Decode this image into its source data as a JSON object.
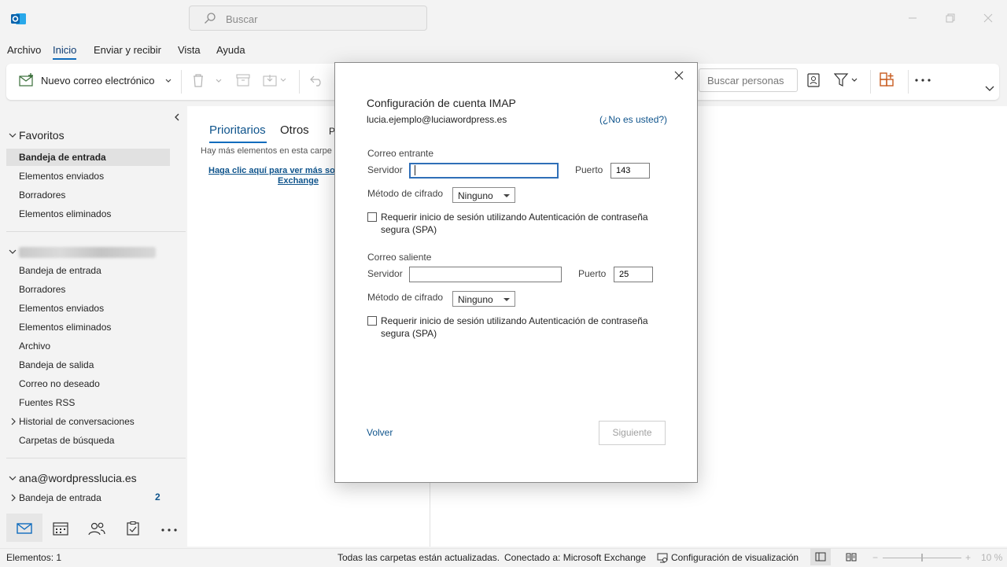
{
  "titlebar": {
    "search_placeholder": "Buscar"
  },
  "menu": {
    "items": [
      "Archivo",
      "Inicio",
      "Enviar y recibir",
      "Vista",
      "Ayuda"
    ]
  },
  "ribbon": {
    "new_mail": "Nuevo correo electrónico",
    "search_people": "Buscar personas"
  },
  "folders": {
    "favorites_header": "Favoritos",
    "favorites": [
      "Bandeja de entrada",
      "Elementos enviados",
      "Borradores",
      "Elementos eliminados"
    ],
    "account1_items": [
      "Bandeja de entrada",
      "Borradores",
      "Elementos enviados",
      "Elementos eliminados",
      "Archivo",
      "Bandeja de salida",
      "Correo no deseado",
      "Fuentes RSS",
      "Historial de conversaciones",
      "Carpetas de búsqueda"
    ],
    "account2_header": "ana@wordpresslucia.es",
    "account2_inbox": "Bandeja de entrada",
    "account2_inbox_count": "2"
  },
  "messages": {
    "tab_focused": "Prioritarios",
    "tab_other": "Otros",
    "tab_partial": "P",
    "notice": "Hay más elementos en esta carpe",
    "link_line1": "Haga clic aquí para ver más sob",
    "link_line2": "Exchange"
  },
  "dialog": {
    "title": "Configuración de cuenta IMAP",
    "email": "lucia.ejemplo@luciawordpress.es",
    "not_you": "(¿No es usted?)",
    "incoming": {
      "header": "Correo entrante",
      "server_label": "Servidor",
      "server_value": "",
      "port_label": "Puerto",
      "port_value": "143",
      "encryption_label": "Método de cifrado",
      "encryption_value": "Ninguno",
      "spa_line1": "Requerir inicio de sesión utilizando Autenticación de contraseña",
      "spa_line2": "segura (SPA)"
    },
    "outgoing": {
      "header": "Correo saliente",
      "server_label": "Servidor",
      "server_value": "",
      "port_label": "Puerto",
      "port_value": "25",
      "encryption_label": "Método de cifrado",
      "encryption_value": "Ninguno",
      "spa_line1": "Requerir inicio de sesión utilizando Autenticación de contraseña",
      "spa_line2": "segura (SPA)"
    },
    "back": "Volver",
    "next": "Siguiente"
  },
  "status": {
    "items_count": "Elementos: 1",
    "folders_updated": "Todas las carpetas están actualizadas.",
    "connected": "Conectado a: Microsoft Exchange",
    "display_settings": "Configuración de visualización",
    "zoom": "10 %"
  },
  "colors": {
    "accent": "#0f6cbd",
    "link": "#0f548c"
  }
}
